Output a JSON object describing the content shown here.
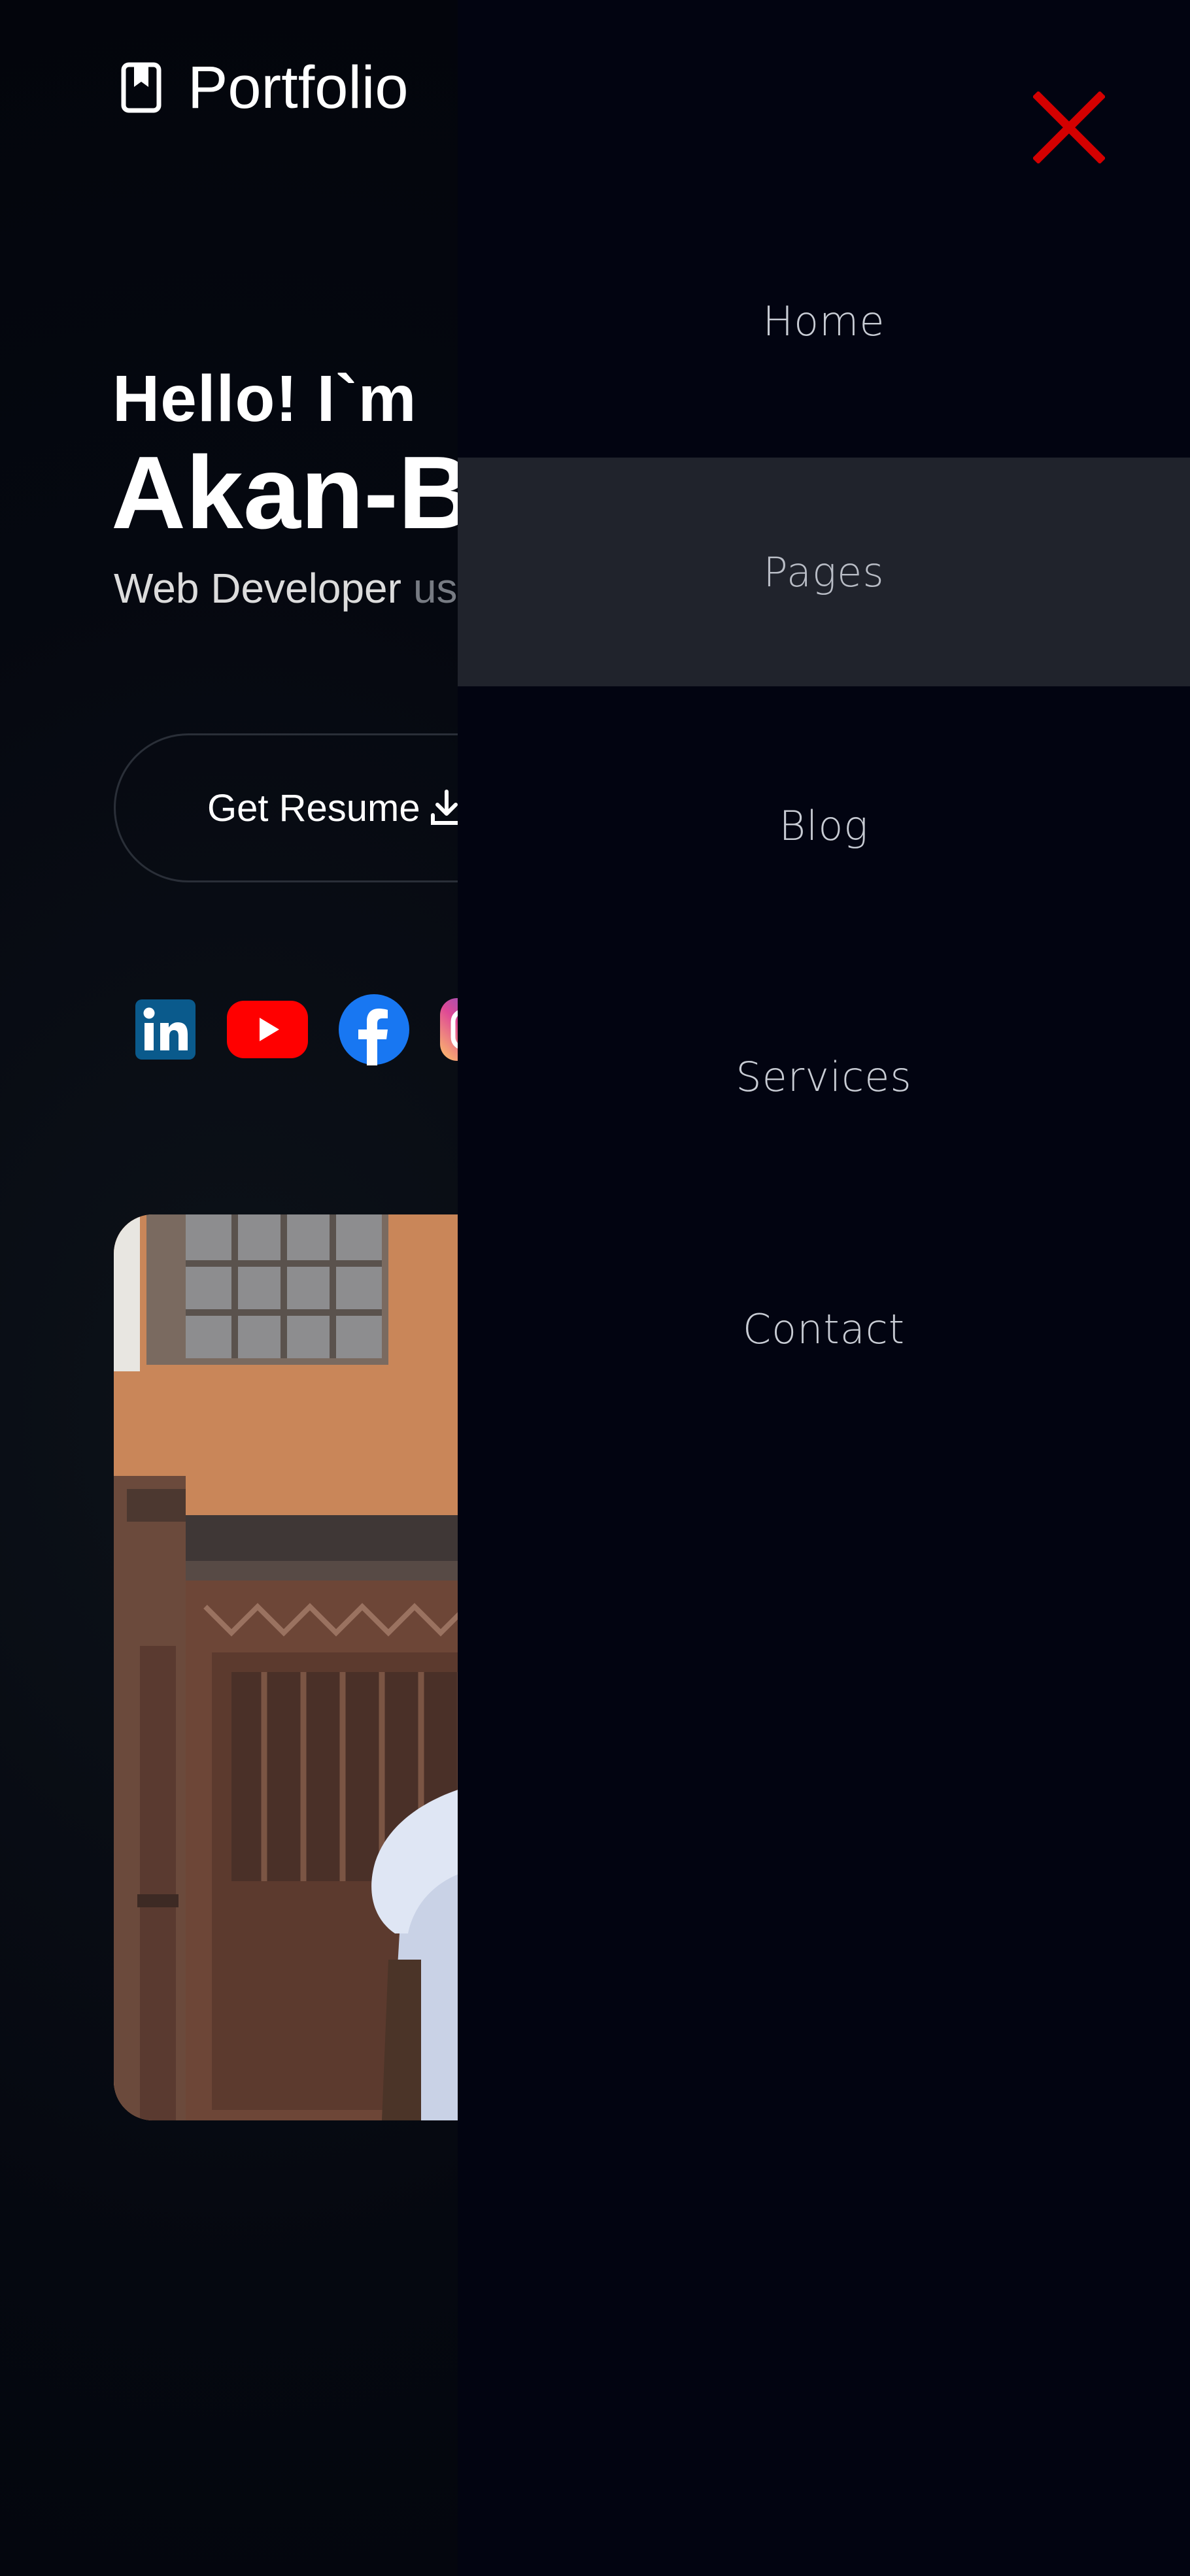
{
  "header": {
    "brand_icon": "bookmark-icon",
    "brand_text": "Portfolio"
  },
  "hero": {
    "greeting": "Hello! I`m",
    "name": "Akan-Be",
    "role_primary": "Web Developer",
    "role_secondary": "us",
    "resume_label": "Get Resume",
    "resume_icon": "download-icon"
  },
  "socials": [
    {
      "icon": "linkedin-icon",
      "color": "#0a66c2"
    },
    {
      "icon": "youtube-icon",
      "color": "#ff0000"
    },
    {
      "icon": "facebook-icon",
      "color": "#1877f2"
    },
    {
      "icon": "instagram-icon",
      "color": "#c13584"
    }
  ],
  "drawer": {
    "close_icon": "close-icon",
    "close_color": "#d40000",
    "items": [
      {
        "label": "Home",
        "active": false
      },
      {
        "label": "Pages",
        "active": true
      },
      {
        "label": "Blog",
        "active": false
      },
      {
        "label": "Services",
        "active": false
      },
      {
        "label": "Contact",
        "active": false
      }
    ]
  }
}
